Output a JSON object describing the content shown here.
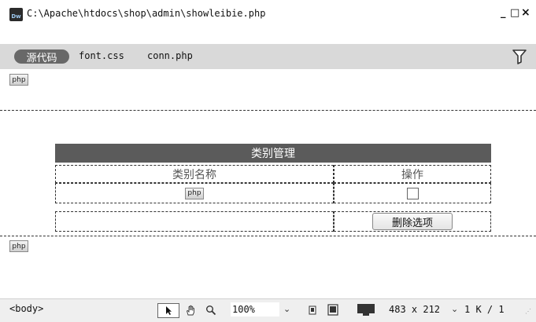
{
  "window": {
    "app_icon": "Dw",
    "title": "C:\\Apache\\htdocs\\shop\\admin\\showleibie.php",
    "minimize": "_",
    "maximize": "□",
    "close": "×"
  },
  "file_bar": {
    "source_label": "源代码",
    "related_files": [
      "font.css",
      "conn.php"
    ],
    "filter_icon": "filter-icon"
  },
  "design": {
    "php_marker": "php",
    "table": {
      "header": "类别管理",
      "col_name": "类别名称",
      "col_action": "操作",
      "delete_button": "删除选项"
    }
  },
  "status_bar": {
    "tag": "<body>",
    "zoom": "100%",
    "dimensions": "483 x 212",
    "size": "1 K / 1"
  }
}
